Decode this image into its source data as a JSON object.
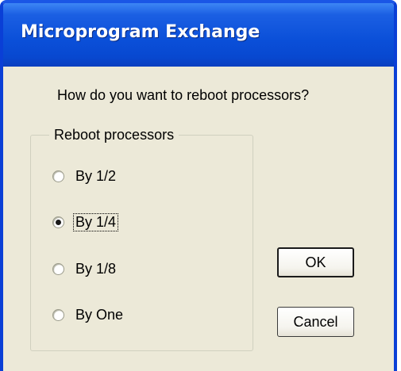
{
  "window": {
    "title": "Microprogram Exchange"
  },
  "dialog": {
    "prompt": "How do you want to reboot processors?",
    "group_label": "Reboot processors",
    "options": [
      {
        "label": "By 1/2",
        "selected": false
      },
      {
        "label": "By 1/4",
        "selected": true
      },
      {
        "label": "By 1/8",
        "selected": false
      },
      {
        "label": "By One",
        "selected": false
      }
    ],
    "ok_label": "OK",
    "cancel_label": "Cancel"
  },
  "colors": {
    "titlebar": "#0a4fd8",
    "dialog_bg": "#ece9d8"
  }
}
